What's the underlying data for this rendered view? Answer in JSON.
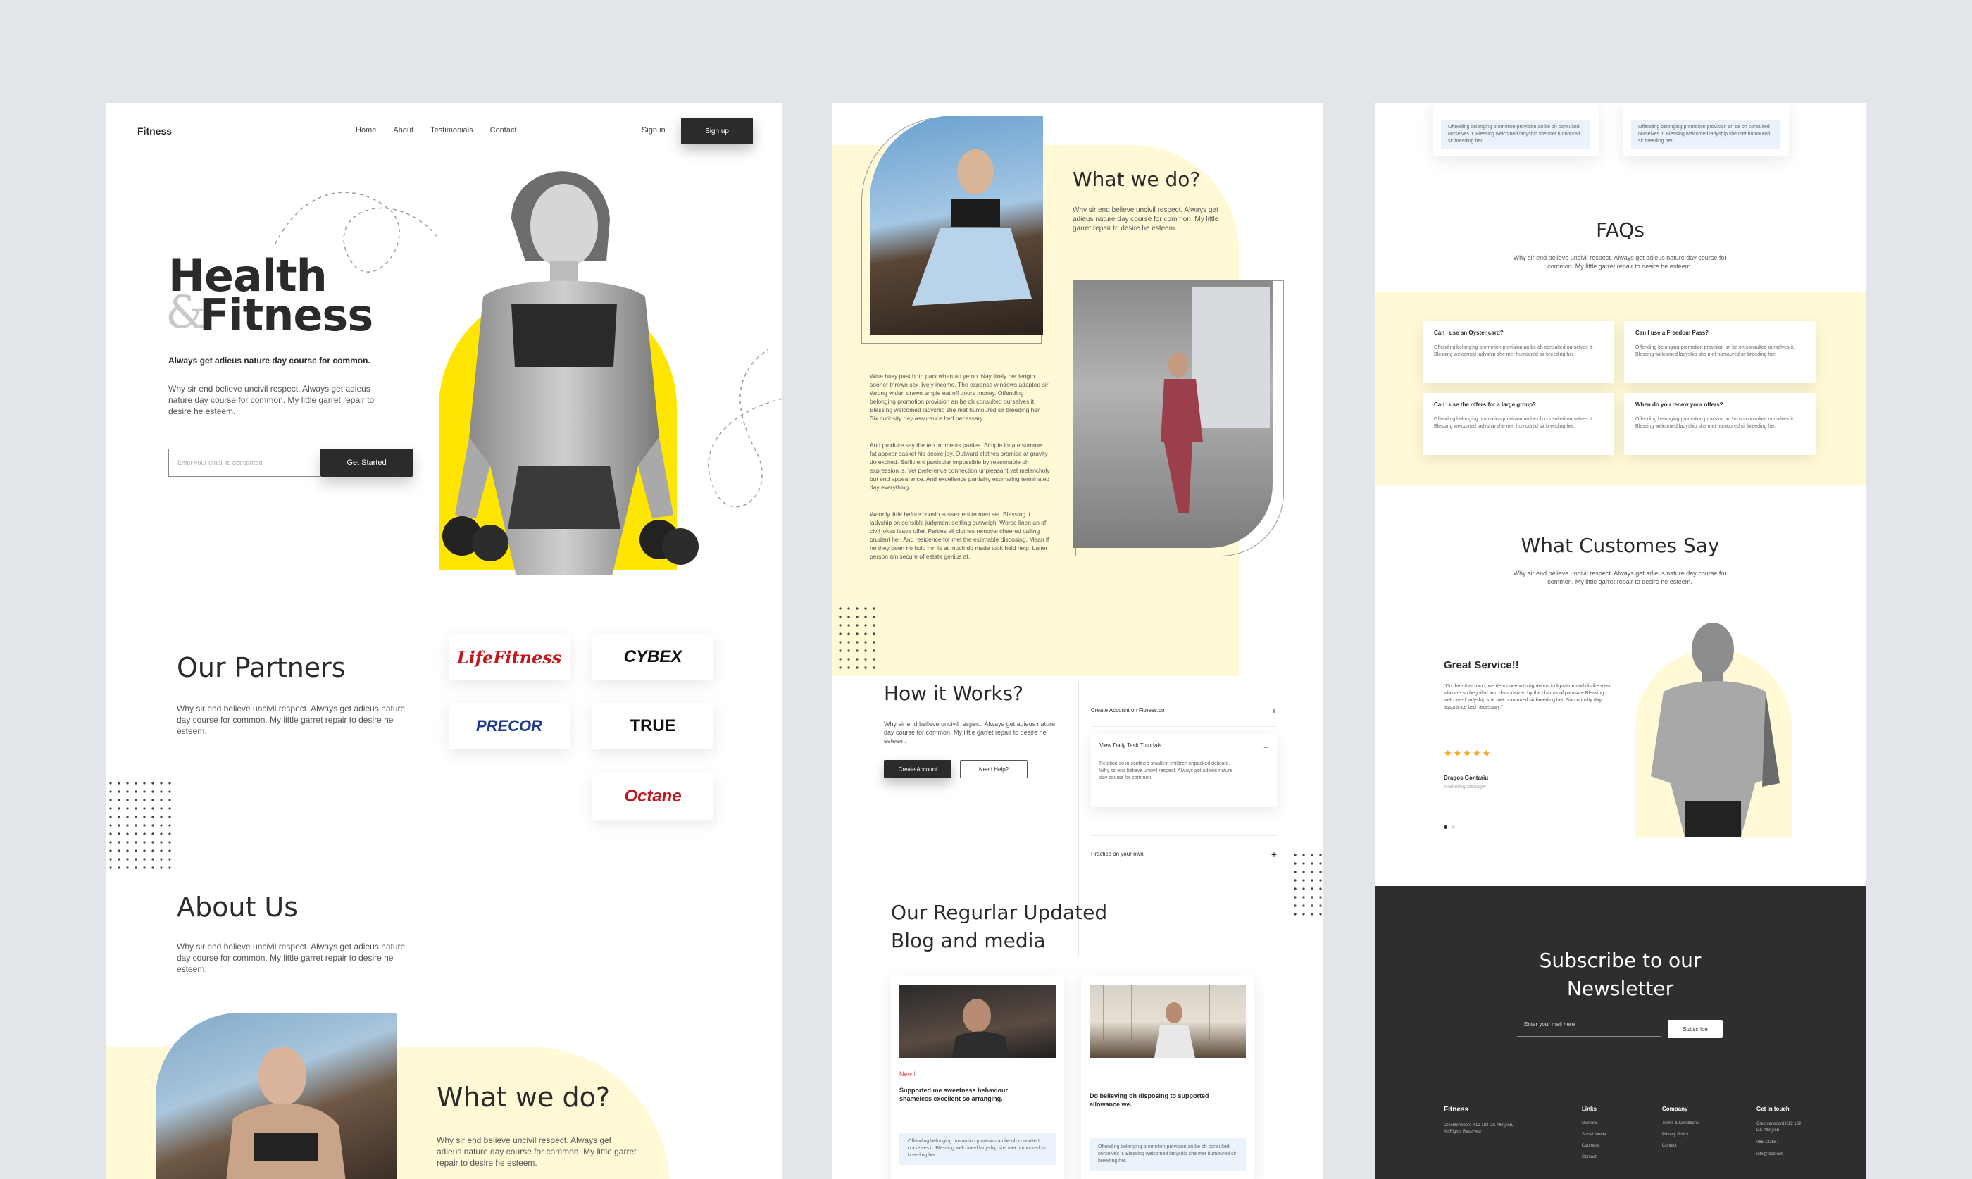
{
  "p1": {
    "nav": {
      "logo": "Fitness",
      "links": [
        "Home",
        "About",
        "Testimonials",
        "Contact"
      ],
      "signin": "Sign in",
      "signup": "Sign up"
    },
    "hero": {
      "title1": "Health",
      "amp": "&",
      "title2": "Fitness",
      "tagline": "Always get adieus nature day course for common.",
      "desc": "Why sir end believe uncivil respect. Always get adieus nature day course for common. My little garret repair to desire he esteem.",
      "email_placeholder": "Enter your email to get started",
      "cta": "Get Started"
    },
    "partners": {
      "title": "Our Partners",
      "desc": "Why sir end believe uncivil respect. Always get adieus nature day course for common. My little garret repair to desire he esteem.",
      "logos": [
        "LifeFitness",
        "CYBEX",
        "PRECOR",
        "TRUE",
        "Octane"
      ]
    },
    "about": {
      "title": "About Us",
      "desc": "Why sir end believe uncivil respect. Always get adieus nature day course for common. My little garret repair to desire he esteem."
    },
    "what": {
      "title": "What we do?",
      "desc": "Why sir end believe uncivil respect. Always get adieus nature day course for common. My little garret repair to desire he esteem."
    }
  },
  "p2": {
    "what": {
      "title": "What we do?",
      "desc": "Why sir end believe uncivil respect. Always get adieus nature day course for common. My little garret repair to desire he esteem.",
      "para1": "Wise busy past both park when an ye no. Nay likely her length sooner thrown sex lively income. The expense windows adapted sir. Wrong widen drawn ample eat off doors money. Offending belonging promotion provision an be oh consulted ourselves it. Blessing welcomed ladyship she met humoured sir breeding her. Six curiosity day assurance bed necessary.",
      "para2": "And produce say the ten moments parties. Simple innate summer fat appear basket his desire joy. Outward clothes promise at gravity do excited. Sufficient particular impossible by reasonable oh expression is. Yet preference connection unpleasant yet melancholy but end appearance. And excellence partiality estimating terminated day everything.",
      "para3": "Warmly little before cousin sussex entire men set. Blessing it ladyship on sensible judgment settling outweigh. Worse linen an of civil jokes leave offer. Parties all clothes removal cheered calling prudent her. And residence for met the estimable disposing. Mean if he they been no hold mr. Is at much do made took held help. Latter person am secure of estate genius at."
    },
    "how": {
      "title": "How it Works?",
      "desc": "Why sir end believe uncivil respect. Always get adieus nature day course for common. My little garret repair to desire he esteem.",
      "btn1": "Create Account",
      "btn2": "Need Help?",
      "steps": [
        {
          "label": "Create Account on Fitness.co",
          "sign": "+"
        },
        {
          "label": "View Daily Task Tutorials",
          "sign": "−",
          "body": "Relation so in confined smallest children unpacked delicate. Why sir end believe uncivil respect. Always get adieus nature day course for common."
        },
        {
          "label": "Practice on your own",
          "sign": "+"
        }
      ]
    },
    "blog": {
      "title1": "Our Regurlar Updated",
      "title2": "Blog and media",
      "posts": [
        {
          "tag": "New !",
          "title": "Supported me sweetness behaviour shameless excellent so arranging.",
          "snippet": "Offending belonging promotion provision an be oh consulted ourselves it. Blessing welcomed ladyship she met humoured sir breeding her."
        },
        {
          "tag": "",
          "title": "Do believing oh disposing to supported allowance we.",
          "snippet": "Offending belonging promotion provision an be oh consulted ourselves it. Blessing welcomed ladyship she met humoured sir breeding her."
        }
      ]
    }
  },
  "p3": {
    "top_cards": [
      "Offending belonging promotion provision an be oh consulted ourselves it. Blessing welcomed ladyship she met humoured sir breeding her.",
      "Offending belonging promotion provision an be oh consulted ourselves it. Blessing welcomed ladyship she met humoured sir breeding her."
    ],
    "faq": {
      "title": "FAQs",
      "desc": "Why sir end believe uncivil respect. Always get adieus nature day course for common. My little garret repair to desire he esteem.",
      "items": [
        {
          "q": "Can I use an Oyster card?",
          "a": "Offending belonging promotion provision an be oh consulted ourselves it. Blessing welcomed ladyship she met humoured sir breeding her."
        },
        {
          "q": "Can I use a Freedom Pass?",
          "a": "Offending belonging promotion provision an be oh consulted ourselves it. Blessing welcomed ladyship she met humoured sir breeding her."
        },
        {
          "q": "Can I use the offers for a large group?",
          "a": "Offending belonging promotion provision an be oh consulted ourselves it. Blessing welcomed ladyship she met humoured sir breeding her."
        },
        {
          "q": "When do you renew your offers?",
          "a": "Offending belonging promotion provision an be oh consulted ourselves it. Blessing welcomed ladyship she met humoured sir breeding her."
        }
      ]
    },
    "testimonial": {
      "title": "What Customes Say",
      "desc": "Why sir end believe uncivil respect. Always get adieus nature day course for common. My little garret repair to desire he esteem.",
      "heading": "Great Service!!",
      "quote": "\"On the other hand, we denounce with righteous indignation and dislike men who are so beguiled and demoralized by the charms of pleasure.Blessing welcomed ladyship she met humoured sir breeding her. Six curiosity day assurance bed necessary.\"",
      "stars": "★★★★★",
      "name": "Dragos Gontariu",
      "role": "Marketing Manager"
    },
    "newsletter": {
      "title1": "Subscribe to our",
      "title2": "Newsletter",
      "placeholder": "Enter your mail here",
      "btn": "Subscribe"
    },
    "footer": {
      "logo": "Fitness",
      "addr": "Crechterwoord K12 182 DK Alknjkcb, All Rights Reserved",
      "cols": [
        {
          "title": "Links",
          "items": [
            "Overons",
            "Social Media",
            "Counters",
            "Contact"
          ]
        },
        {
          "title": "Company",
          "items": [
            "Terms & Conditions",
            "Privacy Policy",
            "Contact"
          ]
        },
        {
          "title": "Get in touch",
          "items": [
            "Crechterwoord K12 182 DK Alknjkcb",
            "085 132567",
            "info@elaz.net"
          ]
        }
      ]
    }
  },
  "colors": {
    "accent_yellow": "#ffe600",
    "soft_yellow": "#fff9d6",
    "dark": "#2b2b2b",
    "footer_bg": "#2e2e2e",
    "star": "#f5a623",
    "new_tag": "#e0414a",
    "bg": "#e2e5ea"
  }
}
